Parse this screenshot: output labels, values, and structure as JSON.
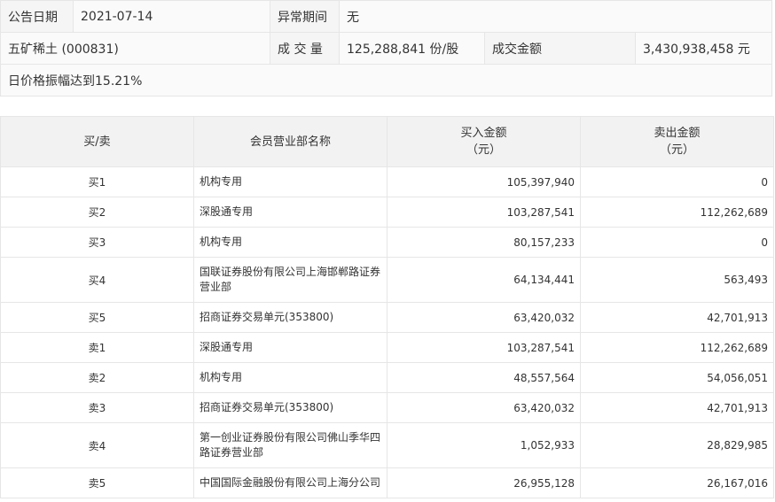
{
  "info": {
    "date_label": "公告日期",
    "date_value": "2021-07-14",
    "period_label": "异常期间",
    "period_value": "无",
    "stock_name": "五矿稀土 (000831)",
    "volume_label": "成 交 量",
    "volume_value": "125,288,841 份/股",
    "amount_label": "成交金额",
    "amount_value": "3,430,938,458 元",
    "reason": "日价格振幅达到15.21%"
  },
  "table": {
    "headers": {
      "direction": "买/卖",
      "branch": "会员营业部名称",
      "buy_line1": "买入金额",
      "buy_line2": "（元）",
      "sell_line1": "卖出金额",
      "sell_line2": "（元）"
    },
    "rows": [
      {
        "direction": "买1",
        "branch": "机构专用",
        "buy": "105,397,940",
        "sell": "0"
      },
      {
        "direction": "买2",
        "branch": "深股通专用",
        "buy": "103,287,541",
        "sell": "112,262,689"
      },
      {
        "direction": "买3",
        "branch": "机构专用",
        "buy": "80,157,233",
        "sell": "0"
      },
      {
        "direction": "买4",
        "branch": "国联证券股份有限公司上海邯郸路证券营业部",
        "buy": "64,134,441",
        "sell": "563,493"
      },
      {
        "direction": "买5",
        "branch": "招商证券交易单元(353800)",
        "buy": "63,420,032",
        "sell": "42,701,913"
      },
      {
        "direction": "卖1",
        "branch": "深股通专用",
        "buy": "103,287,541",
        "sell": "112,262,689"
      },
      {
        "direction": "卖2",
        "branch": "机构专用",
        "buy": "48,557,564",
        "sell": "54,056,051"
      },
      {
        "direction": "卖3",
        "branch": "招商证券交易单元(353800)",
        "buy": "63,420,032",
        "sell": "42,701,913"
      },
      {
        "direction": "卖4",
        "branch": "第一创业证券股份有限公司佛山季华四路证券营业部",
        "buy": "1,052,933",
        "sell": "28,829,985"
      },
      {
        "direction": "卖5",
        "branch": "中国国际金融股份有限公司上海分公司",
        "buy": "26,955,128",
        "sell": "26,167,016"
      }
    ]
  }
}
